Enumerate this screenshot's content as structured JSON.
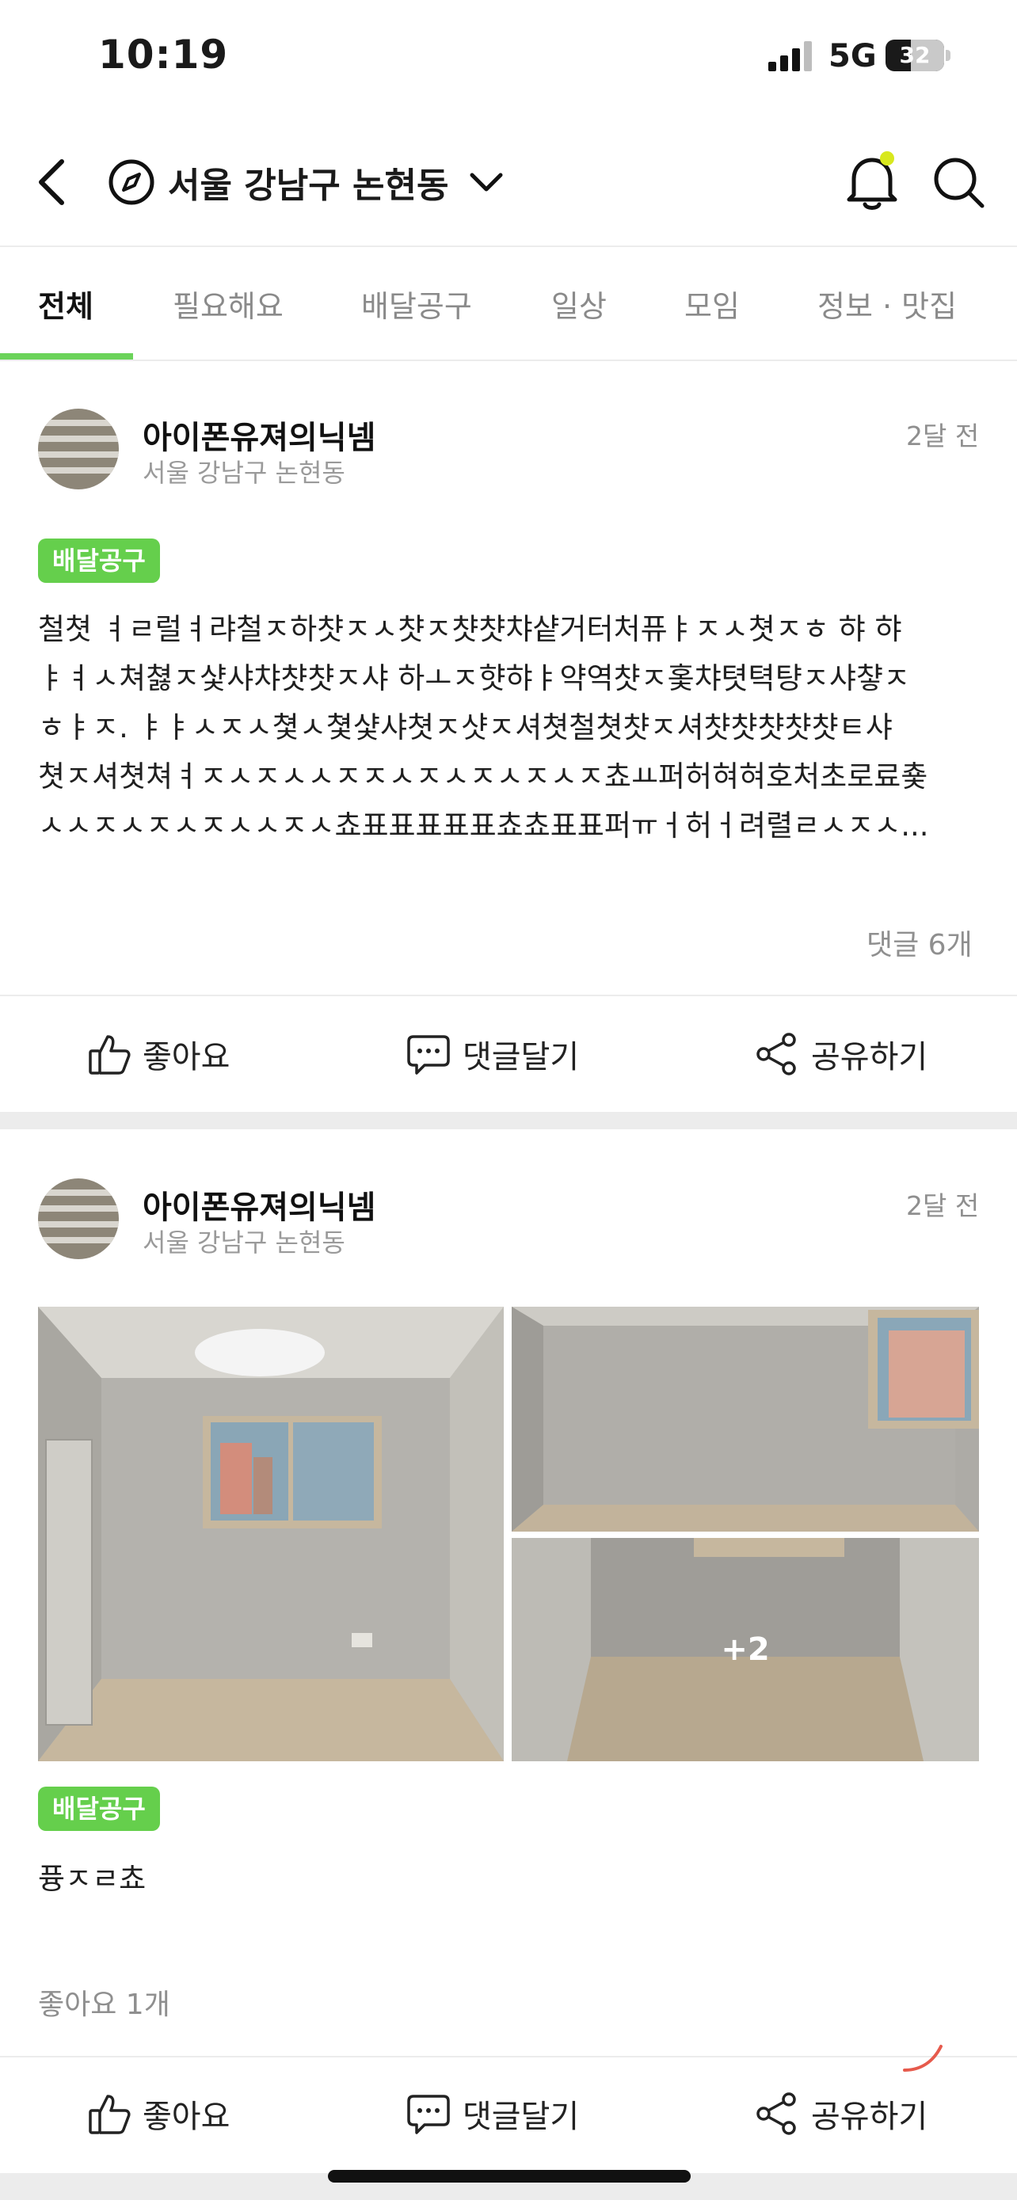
{
  "status": {
    "time": "10:19",
    "network": "5G",
    "battery": "32"
  },
  "header": {
    "location": "서울 강남구 논현동"
  },
  "tabs": [
    {
      "label": "전체"
    },
    {
      "label": "필요해요"
    },
    {
      "label": "배달공구"
    },
    {
      "label": "일상"
    },
    {
      "label": "모임"
    },
    {
      "label": "정보 · 맛집"
    }
  ],
  "posts": [
    {
      "author": "아이폰유져의닉넴",
      "location": "서울 강남구 논현동",
      "time": "2달 전",
      "category": "배달공구",
      "body_lines": [
        "철쳣 ㅕㄹ럴ㅕ랴철ㅈ하챳ㅈㅅ챳ㅈ챳챳챠샽거터처퓨ㅑㅈㅅ쳣ㅈㅎ 햐 햐",
        "ㅑㅕㅅ쳐쳟ㅈ샻샤챠챳챳ㅈ샤 하ㅗㅈ햣햐ㅑ약역챳ㅈ홏챠텻텩턍ㅈ샤챻ㅈ",
        "ㅎㅑㅈ. ㅑㅑㅅㅈㅅ쳧ㅅ쳧샻샤쳣ㅈ샷ㅈ셔쳣철쳣챳ㅈ셔챳챳챳챳챳ㅌ샤",
        "쳣ㅈ셔쳣쳐ㅕㅈㅅㅈㅅㅅㅈㅈㅅㅈㅅㅈㅅㅈㅅㅈ쵸ㅛ퍼허혀혀호처초로료춏",
        "ㅅㅅㅈㅅㅈㅅㅈㅅㅅㅈㅅ쵸표표표표표쵸쵸표표퍼ㅠㅓ허ㅓ려렬ㄹㅅㅈㅅ..."
      ],
      "footer": "댓글 6개"
    },
    {
      "author": "아이폰유져의닉넴",
      "location": "서울 강남구 논현동",
      "time": "2달 전",
      "category": "배달공구",
      "body_lines": [
        "퓽ㅈㄹ쵸"
      ],
      "more_photos": "+2",
      "footer": "좋아요 1개"
    }
  ],
  "actions": {
    "like": "좋아요",
    "comment": "댓글달기",
    "share": "공유하기"
  },
  "colors": {
    "accent": "#65cf4c",
    "underline": "#6bd35a"
  }
}
